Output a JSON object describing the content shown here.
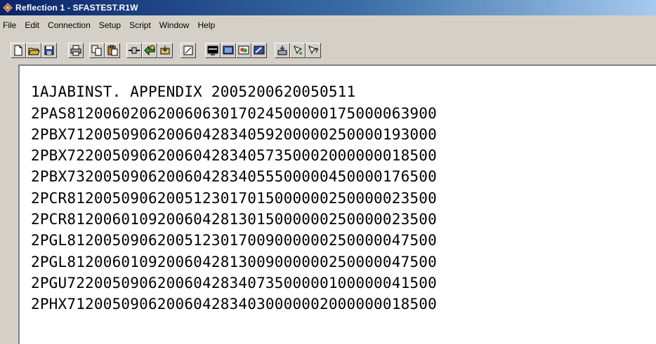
{
  "window": {
    "title": "Reflection 1 - SFASTEST.R1W"
  },
  "menu": [
    "File",
    "Edit",
    "Connection",
    "Setup",
    "Script",
    "Window",
    "Help"
  ],
  "toolbar": [
    {
      "name": "new-icon"
    },
    {
      "name": "open-icon"
    },
    {
      "name": "save-icon"
    },
    {
      "name": "print-icon"
    },
    {
      "name": "copy-icon"
    },
    {
      "name": "paste-icon"
    },
    {
      "name": "connect-icon"
    },
    {
      "name": "transfer-icon"
    },
    {
      "name": "receive-icon"
    },
    {
      "name": "notes-icon"
    },
    {
      "name": "display-setup-icon"
    },
    {
      "name": "terminal-setup-icon"
    },
    {
      "name": "color-icon"
    },
    {
      "name": "keyboard-map-icon"
    },
    {
      "name": "host-icon"
    },
    {
      "name": "mouse-icon"
    },
    {
      "name": "help-icon"
    }
  ],
  "terminal": {
    "lines": [
      "1AJABINST. APPENDIX 2005200620050511",
      "2PAS81200602062006063017024500000175000063900",
      "2PBX71200509062006042834059200000250000193000",
      "2PBX72200509062006042834057350002000000018500",
      "2PBX73200509062006042834055500000450000176500",
      "2PCR81200509062005123017015000000250000023500",
      "2PCR81200601092006042813015000000250000023500",
      "2PGL81200509062005123017009000000250000047500",
      "2PGL81200601092006042813009000000250000047500",
      "2PGU72200509062006042834073500000100000041500",
      "2PHX71200509062006042834030000002000000018500"
    ]
  }
}
